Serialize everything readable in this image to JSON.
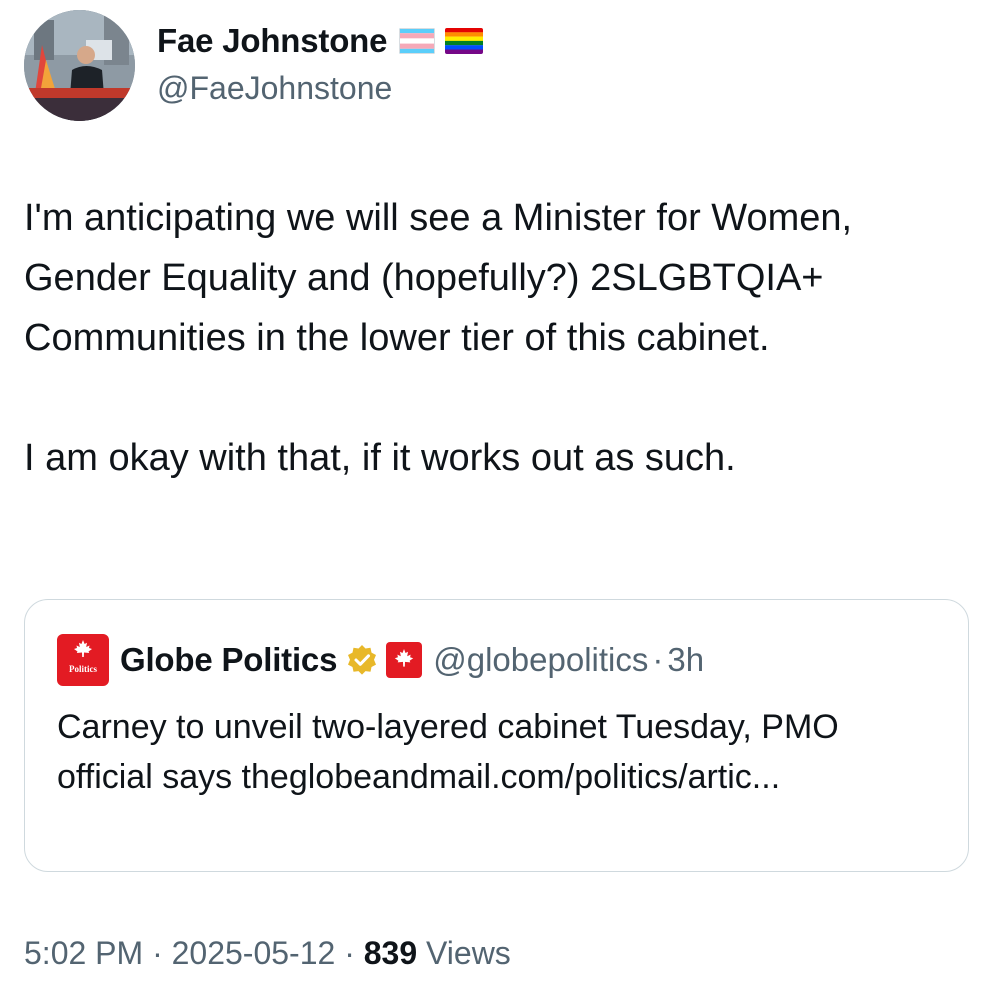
{
  "author": {
    "display_name": "Fae Johnstone",
    "handle": "@FaeJohnstone",
    "flags": [
      "transgender-flag-icon",
      "rainbow-flag-icon"
    ]
  },
  "tweet": {
    "paragraphs": [
      "I'm anticipating we will see a Minister for Women, Gender Equality and (hopefully?) 2SLGBTQIA+ Communities in the lower tier of this cabinet.",
      "I am okay with that, if it works out as such."
    ]
  },
  "quote": {
    "avatar_label": "Politics",
    "display_name": "Globe Politics",
    "handle": "@globepolitics",
    "separator": "·",
    "time": "3h",
    "text": "Carney to unveil two-layered cabinet Tuesday, PMO official says theglobeandmail.com/politics/artic...",
    "badges": [
      "verified-gold-badge-icon",
      "canada-flag-icon"
    ],
    "colors": {
      "avatar_bg": "#e31b23",
      "verified_gold": "#e8b829"
    }
  },
  "meta": {
    "time": "5:02 PM",
    "separator": "·",
    "date": "2025-05-12",
    "views_count": "839",
    "views_label": "Views"
  },
  "colors": {
    "text_primary": "#0f1419",
    "text_secondary": "#536471",
    "border": "#cfd9de"
  }
}
